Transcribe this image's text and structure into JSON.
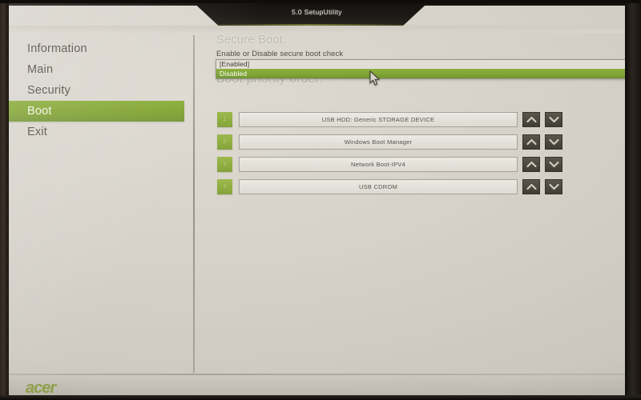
{
  "window": {
    "title": "5.0 SetupUtility"
  },
  "sidebar": {
    "items": [
      {
        "label": "Information",
        "selected": false
      },
      {
        "label": "Main",
        "selected": false
      },
      {
        "label": "Security",
        "selected": false
      },
      {
        "label": "Boot",
        "selected": true
      },
      {
        "label": "Exit",
        "selected": false
      }
    ]
  },
  "main": {
    "secure_boot": {
      "title": "Secure Boot:",
      "description": "Enable or Disable secure boot check",
      "options": [
        {
          "label": "[Enabled]",
          "active": false
        },
        {
          "label": "Disabled",
          "active": true
        }
      ],
      "selected_value": "Disabled"
    },
    "boot_priority": {
      "heading": "Boot priority order:",
      "items": [
        {
          "index": "1",
          "label": "USB HDD: Generic STORAGE DEVICE"
        },
        {
          "index": "2",
          "label": "Windows Boot Manager"
        },
        {
          "index": "3",
          "label": "Network Boot-IPV4"
        },
        {
          "index": "4",
          "label": "USB CDROM"
        }
      ],
      "move_up_label": "Move up",
      "move_down_label": "Move down"
    }
  },
  "footer": {
    "brand": "acer"
  },
  "icons": {
    "chevron_up": "chevron-up-icon",
    "chevron_down": "chevron-down-icon",
    "cursor": "mouse-cursor-icon"
  },
  "colors": {
    "accent_green": "#83a535",
    "badge_green": "#8fae41",
    "screen_bg": "#d6d2ca",
    "brand_green": "#8a9b3e",
    "title_bar": "#1d1b16"
  }
}
